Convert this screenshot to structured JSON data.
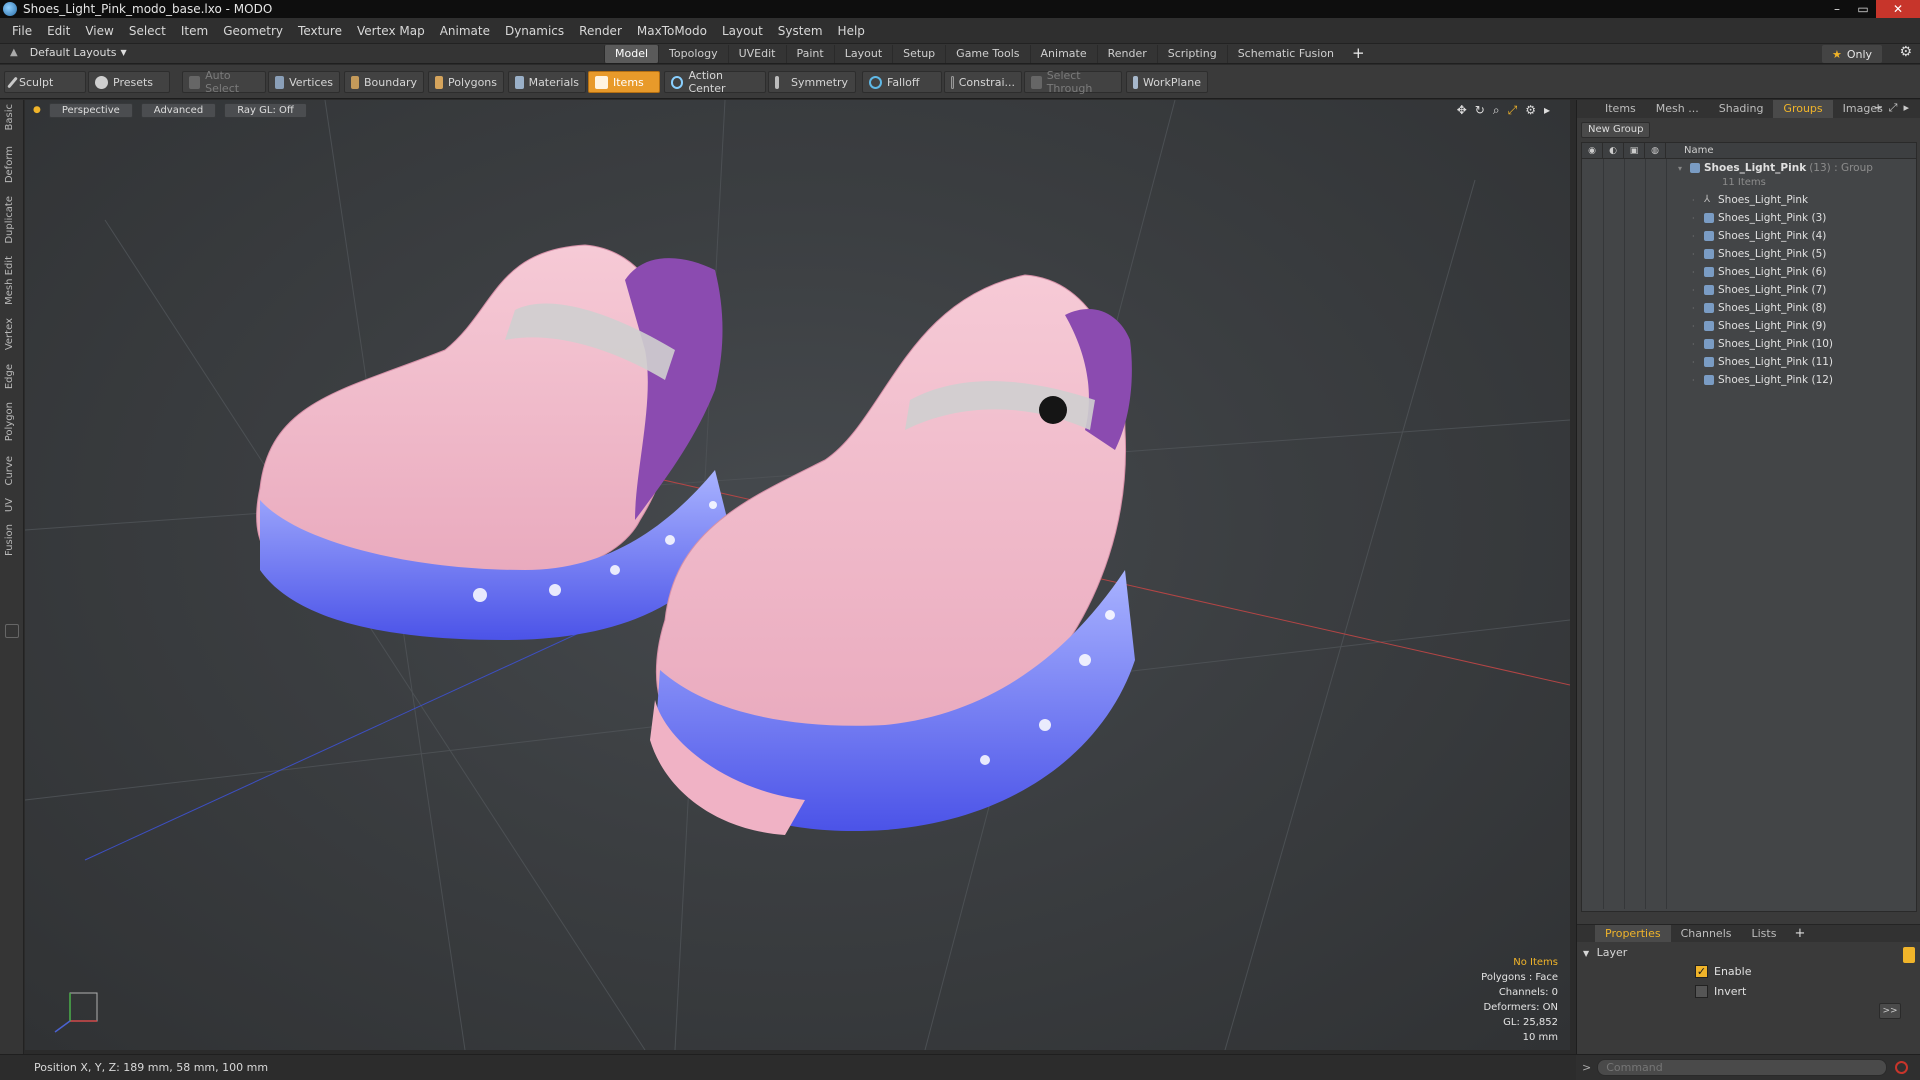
{
  "window": {
    "title": "Shoes_Light_Pink_modo_base.lxo - MODO",
    "controls": [
      "–",
      "▭",
      "✕"
    ]
  },
  "menu": [
    "File",
    "Edit",
    "View",
    "Select",
    "Item",
    "Geometry",
    "Texture",
    "Vertex Map",
    "Animate",
    "Dynamics",
    "Render",
    "MaxToModo",
    "Layout",
    "System",
    "Help"
  ],
  "layout_bar": {
    "layouts_label": "Default Layouts",
    "tabs": [
      "Model",
      "Topology",
      "UVEdit",
      "Paint",
      "Layout",
      "Setup",
      "Game Tools",
      "Animate",
      "Render",
      "Scripting",
      "Schematic Fusion"
    ],
    "active_tab": "Model",
    "only_label": "Only"
  },
  "toolbar": {
    "sculpt": "Sculpt",
    "presets": "Presets",
    "auto_select": "Auto Select",
    "vertices": "Vertices",
    "boundary": "Boundary",
    "polygons": "Polygons",
    "materials": "Materials",
    "items": "Items",
    "action_center": "Action Center",
    "symmetry": "Symmetry",
    "falloff": "Falloff",
    "constraints": "Constrai...",
    "select_through": "Select Through",
    "workplane": "WorkPlane"
  },
  "left_tabs": [
    "Basic",
    "Deform",
    "Duplicate",
    "Mesh Edit",
    "Vertex",
    "Edge",
    "Polygon",
    "Curve",
    "UV",
    "Fusion"
  ],
  "viewport": {
    "view_mode": "Perspective",
    "shading": "Advanced",
    "raygl": "Ray GL: Off",
    "info": {
      "selection": "No Items",
      "polygons": "Polygons : Face",
      "channels": "Channels: 0",
      "deformers": "Deformers: ON",
      "gl": "GL: 25,852",
      "scale": "10 mm"
    }
  },
  "right_panel": {
    "tabs": [
      "Items",
      "Mesh ...",
      "Shading",
      "Groups",
      "Images"
    ],
    "active_tab": "Groups",
    "new_group": "New Group",
    "list_header": "Name",
    "group": {
      "name": "Shoes_Light_Pink",
      "suffix": "(13) : Group",
      "count": "11 Items"
    },
    "items": [
      "Shoes_Light_Pink",
      "Shoes_Light_Pink (3)",
      "Shoes_Light_Pink (4)",
      "Shoes_Light_Pink (5)",
      "Shoes_Light_Pink (6)",
      "Shoes_Light_Pink (7)",
      "Shoes_Light_Pink (8)",
      "Shoes_Light_Pink (9)",
      "Shoes_Light_Pink (10)",
      "Shoes_Light_Pink (11)",
      "Shoes_Light_Pink (12)"
    ]
  },
  "properties": {
    "tabs": [
      "Properties",
      "Channels",
      "Lists"
    ],
    "active_tab": "Properties",
    "section": "Layer",
    "enable_label": "Enable",
    "enable_checked": true,
    "invert_label": "Invert",
    "invert_checked": false,
    "expand_label": ">>"
  },
  "status": {
    "position": "Position X, Y, Z:  189 mm, 58 mm, 100 mm"
  },
  "command": {
    "placeholder": "Command"
  },
  "colors": {
    "accent": "#f0b42a",
    "shoe_pink": "#f2b9c9",
    "sole_blue": "#6f7cf2",
    "collar_purple": "#8b4bb0"
  }
}
